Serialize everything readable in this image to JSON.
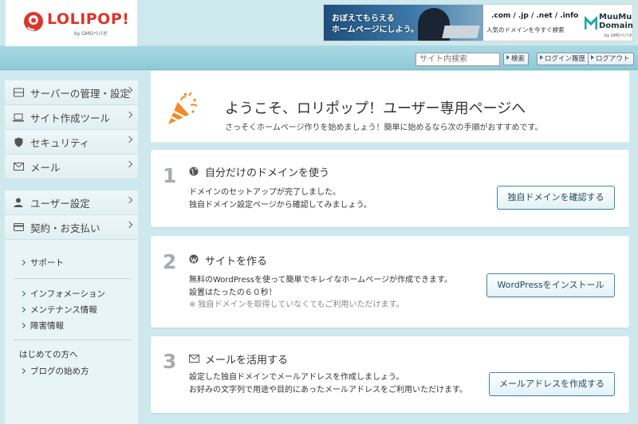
{
  "header": {
    "logo_text": "LOLIPOP!",
    "logo_sub": "by GMOペパボ",
    "banner": {
      "line1": "おぼえてもらえる",
      "line2": "ホームページにしよう。",
      "domains": ".com / .jp / .net / .info",
      "caption": "人気のドメインを今すぐ検索",
      "brand_line1": "MuuMuu",
      "brand_line2": "Domain",
      "brand_sub": "by GMOペパボ"
    }
  },
  "subbar": {
    "search_placeholder": "サイト内検索",
    "search_button": "検索",
    "login_history_button": "ログイン履歴",
    "logout_button": "ログアウト"
  },
  "sidebar": {
    "menu": [
      {
        "label": "サーバーの管理・設定",
        "icon": "server-icon"
      },
      {
        "label": "サイト作成ツール",
        "icon": "laptop-icon"
      },
      {
        "label": "セキュリティ",
        "icon": "shield-icon"
      },
      {
        "label": "メール",
        "icon": "mail-icon"
      }
    ],
    "menu2": [
      {
        "label": "ユーザー設定",
        "icon": "user-icon"
      },
      {
        "label": "契約・お支払い",
        "icon": "card-icon"
      }
    ],
    "support_link": "サポート",
    "info_links": [
      "インフォメーション",
      "メンテナンス情報",
      "障害情報"
    ],
    "beginner_label": "はじめての方へ",
    "blog_link": "ブログの始め方"
  },
  "welcome": {
    "title": "ようこそ、ロリポップ！ユーザー専用ページへ",
    "subtitle": "さっそくホームページ作りを始めましょう！簡単に始めるなら次の手順がおすすめです。"
  },
  "steps": [
    {
      "number": "1",
      "icon": "globe-icon",
      "title": "自分だけのドメインを使う",
      "lines": [
        "ドメインのセットアップが完了しました。",
        "独自ドメイン設定ページから確認してみましょう。"
      ],
      "note": "",
      "button": "独自ドメインを確認する"
    },
    {
      "number": "2",
      "icon": "wordpress-icon",
      "title": "サイトを作る",
      "lines": [
        "無料のWordPressを使って簡単でキレイなホームページが作成できます。",
        "設置はたったの６０秒！"
      ],
      "note": "※ 独自ドメインを取得していなくてもご利用いただけます。",
      "button": "WordPressをインストール"
    },
    {
      "number": "3",
      "icon": "mail-icon",
      "title": "メールを活用する",
      "lines": [
        "設定した独自ドメインでメールアドレスを作成しましょう。",
        "お好みの文字列で用途や目的にあったメールアドレスをご利用いただけます。"
      ],
      "note": "",
      "button": "メールアドレスを作成する"
    }
  ],
  "colors": {
    "brand_red": "#e0342a",
    "background": "#cde9ee",
    "button_border": "#3e88aa"
  }
}
